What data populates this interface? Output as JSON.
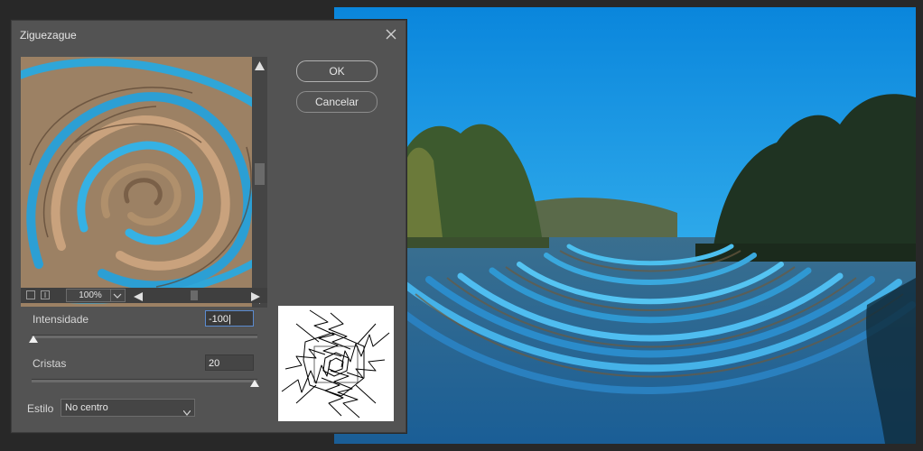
{
  "dialog": {
    "title": "Ziguezague",
    "close_icon": "close-icon",
    "ok_label": "OK",
    "cancel_label": "Cancelar"
  },
  "preview": {
    "zoom": "100%"
  },
  "controls": {
    "intensity": {
      "label": "Intensidade",
      "value": "-100",
      "min": -100,
      "max": 100
    },
    "ridges": {
      "label": "Cristas",
      "value": "20",
      "min": 1,
      "max": 20
    },
    "style": {
      "label": "Estilo",
      "selected": "No centro"
    }
  },
  "colors": {
    "dialog_bg": "#535353",
    "app_bg": "#282828",
    "sky": "#1a8fe0",
    "water": "#1d6fa8",
    "swirl_blue": "#2fa6d8",
    "swirl_tan": "#a68a6c"
  }
}
